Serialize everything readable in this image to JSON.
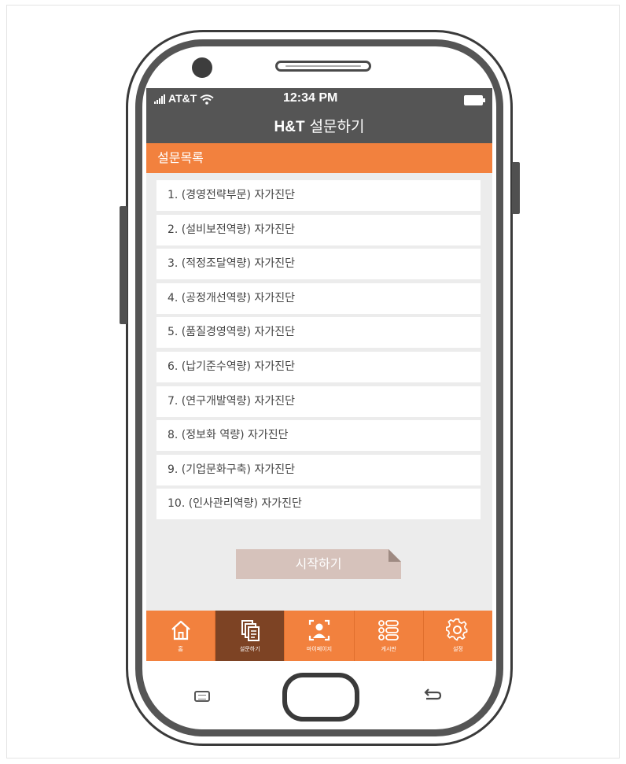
{
  "status": {
    "carrier": "AT&T",
    "time": "12:34 PM"
  },
  "header": {
    "brand": "H&T",
    "title": "설문하기"
  },
  "section": {
    "title": "설문목록"
  },
  "surveys": [
    "1. (경영전략부문) 자가진단",
    "2. (설비보전역량) 자가진단",
    "3. (적정조달역량) 자가진단",
    "4. (공정개선역량) 자가진단",
    "5. (품질경영역량) 자가진단",
    "6. (납기준수역량) 자가진단",
    "7. (연구개발역량) 자가진단",
    "8. (정보화 역량) 자가진단",
    "9. (기업문화구축) 자가진단",
    "10. (인사관리역량) 자가진단"
  ],
  "start_button": "시작하기",
  "nav": [
    {
      "label": "홈",
      "icon": "home-icon",
      "active": false
    },
    {
      "label": "설문하기",
      "icon": "documents-icon",
      "active": true
    },
    {
      "label": "마이페이지",
      "icon": "user-icon",
      "active": false
    },
    {
      "label": "게시판",
      "icon": "list-icon",
      "active": false
    },
    {
      "label": "설정",
      "icon": "gear-icon",
      "active": false
    }
  ],
  "colors": {
    "accent": "#f2813e",
    "header_bg": "#555555",
    "nav_active": "#7d4324",
    "start_button_bg": "#d6c2bb"
  }
}
